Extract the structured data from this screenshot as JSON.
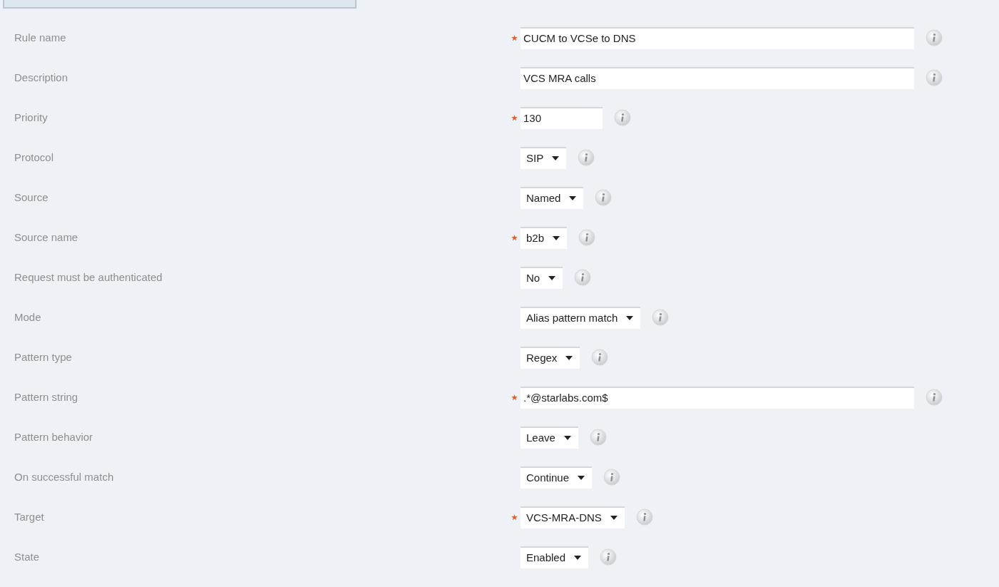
{
  "fields": [
    {
      "label": "Rule name",
      "kind": "text",
      "required": true,
      "value": "CUCM to VCSe to DNS"
    },
    {
      "label": "Description",
      "kind": "text",
      "required": false,
      "value": "VCS MRA calls"
    },
    {
      "label": "Priority",
      "kind": "number",
      "required": true,
      "value": "130"
    },
    {
      "label": "Protocol",
      "kind": "select",
      "required": false,
      "value": "SIP"
    },
    {
      "label": "Source",
      "kind": "select",
      "required": false,
      "value": "Named"
    },
    {
      "label": "Source name",
      "kind": "select",
      "required": true,
      "value": "b2b"
    },
    {
      "label": "Request must be authenticated",
      "kind": "select",
      "required": false,
      "value": "No"
    },
    {
      "label": "Mode",
      "kind": "select",
      "required": false,
      "value": "Alias pattern match"
    },
    {
      "label": "Pattern type",
      "kind": "select",
      "required": false,
      "value": "Regex"
    },
    {
      "label": "Pattern string",
      "kind": "text",
      "required": true,
      "value": ".*@starlabs.com$"
    },
    {
      "label": "Pattern behavior",
      "kind": "select",
      "required": false,
      "value": "Leave"
    },
    {
      "label": "On successful match",
      "kind": "select",
      "required": false,
      "value": "Continue"
    },
    {
      "label": "Target",
      "kind": "select",
      "required": true,
      "value": "VCS-MRA-DNS"
    },
    {
      "label": "State",
      "kind": "select",
      "required": false,
      "value": "Enabled"
    }
  ]
}
